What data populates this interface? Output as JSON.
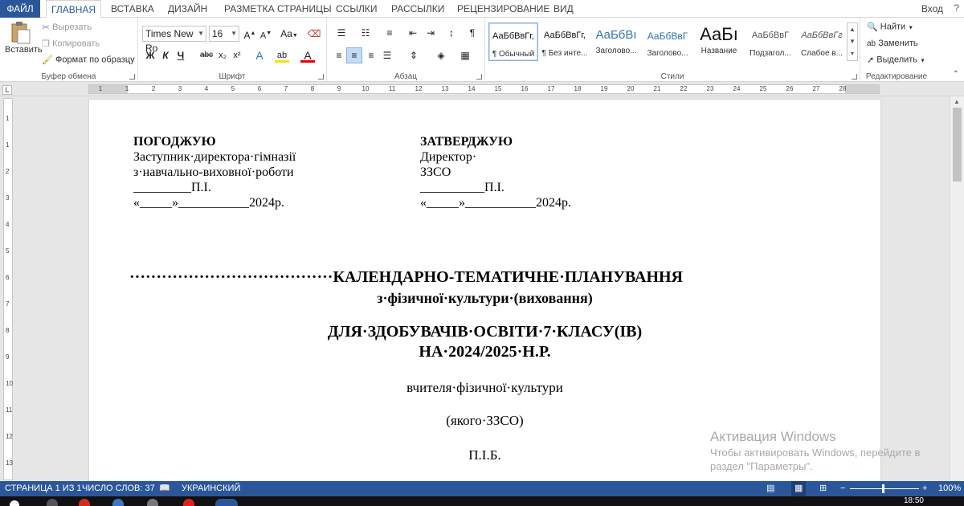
{
  "tabs": {
    "file": "ФАЙЛ",
    "items": [
      "ГЛАВНАЯ",
      "ВСТАВКА",
      "ДИЗАЙН",
      "РАЗМЕТКА СТРАНИЦЫ",
      "ССЫЛКИ",
      "РАССЫЛКИ",
      "РЕЦЕНЗИРОВАНИЕ",
      "ВИД"
    ],
    "signin": "Вход",
    "help": "?"
  },
  "clipboard": {
    "paste": "Вставить",
    "cut": "Вырезать",
    "copy": "Копировать",
    "format_painter": "Формат по образцу",
    "label": "Буфер обмена"
  },
  "font": {
    "name": "Times New Ro",
    "size": "16",
    "grow": "A",
    "shrink": "A",
    "case": "Aa",
    "bold": "Ж",
    "italic": "К",
    "underline": "Ч",
    "strike": "abc",
    "subscript": "x₂",
    "superscript": "x²",
    "effects": "A",
    "highlight": "ab",
    "color": "A",
    "label": "Шрифт"
  },
  "paragraph": {
    "pilcrow": "¶",
    "label": "Абзац"
  },
  "styles": {
    "items": [
      {
        "sample": "АаБбВвГг,",
        "name": "¶ Обычный"
      },
      {
        "sample": "АаБбВвГг,",
        "name": "¶ Без инте..."
      },
      {
        "sample": "АаБбВı",
        "name": "Заголово..."
      },
      {
        "sample": "АаБбВвГ",
        "name": "Заголово..."
      },
      {
        "sample": "АаБı",
        "name": "Название"
      },
      {
        "sample": "АаБбВвГ",
        "name": "Подзагол..."
      },
      {
        "sample": "АаБбВвГг",
        "name": "Слабое в..."
      }
    ],
    "label": "Стили"
  },
  "editing": {
    "find": "Найти",
    "replace": "Заменить",
    "select": "Выделить",
    "label": "Редактирование"
  },
  "ruler": {
    "marks": [
      "1",
      "1",
      "2",
      "3",
      "4",
      "5",
      "6",
      "7",
      "8",
      "9",
      "10",
      "11",
      "12",
      "13",
      "14",
      "15",
      "16",
      "17",
      "18",
      "19",
      "20",
      "21",
      "22",
      "23",
      "24",
      "25",
      "26",
      "27",
      "28"
    ],
    "vmarks": [
      "1",
      "1",
      "2",
      "3",
      "4",
      "5",
      "6",
      "7",
      "8",
      "9",
      "10",
      "11",
      "12",
      "13"
    ],
    "corner": "L"
  },
  "document": {
    "agree": {
      "title": "ПОГОДЖУЮ",
      "l1": "Заступник·директора·гімназії",
      "l2": "з·навчально-виховної·роботи",
      "l3": "_________П.І.",
      "l4": "«_____»___________2024р."
    },
    "approve": {
      "title": "ЗАТВЕРДЖУЮ",
      "l1": "Директор·",
      "l2": "ЗЗСО",
      "l3": "__________П.І.",
      "l4": "«_____»___________2024р."
    },
    "title_line": "······································КАЛЕНДАРНО-ТЕМАТИЧНЕ·ПЛАНУВАННЯ",
    "subject": "з·фізичної·культури·(виховання)",
    "students": "ДЛЯ·ЗДОБУВАЧІВ·ОСВІТИ·7·КЛАСУ(ІВ)",
    "year": "НА·2024/2025·Н.Р.",
    "teacher": "вчителя·фізичної·культури",
    "school": "(якого·ЗЗСО)",
    "pib": "П.І.Б."
  },
  "watermark": {
    "line1": "Активация Windows",
    "line2": "Чтобы активировать Windows, перейдите в",
    "line3": "раздел \"Параметры\"."
  },
  "status": {
    "page": "СТРАНИЦА 1 ИЗ 1",
    "words": "ЧИСЛО СЛОВ: 37",
    "language": "УКРАИНСКИЙ",
    "zoom": "100%"
  },
  "taskbar": {
    "time": "18:50"
  }
}
